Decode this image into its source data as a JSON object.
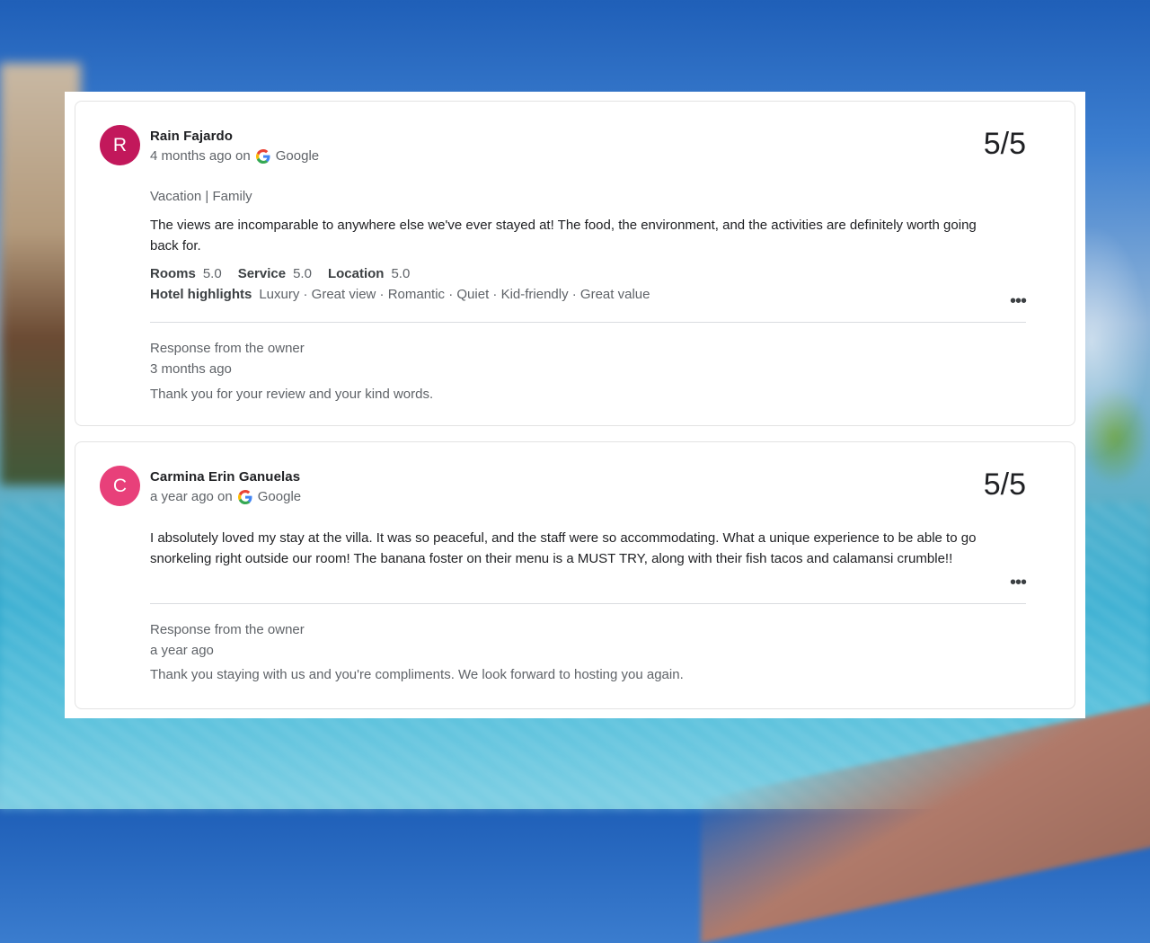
{
  "reviews": [
    {
      "avatar_letter": "R",
      "avatar_color": "#c2185b",
      "name": "Rain Fajardo",
      "time": "4 months ago on",
      "source": "Google",
      "score": "5/5",
      "tagline": "Vacation | Family",
      "text": "The views are incomparable to anywhere else we've ever stayed at! The food, the environment, and the activities are definitely worth going back for.",
      "ratings": [
        {
          "label": "Rooms",
          "value": "5.0"
        },
        {
          "label": "Service",
          "value": "5.0"
        },
        {
          "label": "Location",
          "value": "5.0"
        }
      ],
      "highlights_label": "Hotel highlights",
      "highlights": "Luxury · Great view · Romantic · Quiet · Kid-friendly · Great value",
      "more_label": "•••",
      "response_title": "Response from the owner",
      "response_time": "3 months ago",
      "response_text": "Thank you for your review and your kind words."
    },
    {
      "avatar_letter": "C",
      "avatar_color": "#e8407a",
      "name": "Carmina Erin Ganuelas",
      "time": "a year ago on",
      "source": "Google",
      "score": "5/5",
      "text": "I absolutely loved my stay at the villa. It was so peaceful, and the staff were so accommodating. What a unique experience to be able to go snorkeling right outside our room! The banana foster on their menu is a MUST TRY, along with their fish tacos and calamansi crumble!!",
      "more_label": "•••",
      "response_title": "Response from the owner",
      "response_time": "a year ago",
      "response_text": "Thank you staying with us and you're compliments. We look forward to hosting you again."
    }
  ]
}
